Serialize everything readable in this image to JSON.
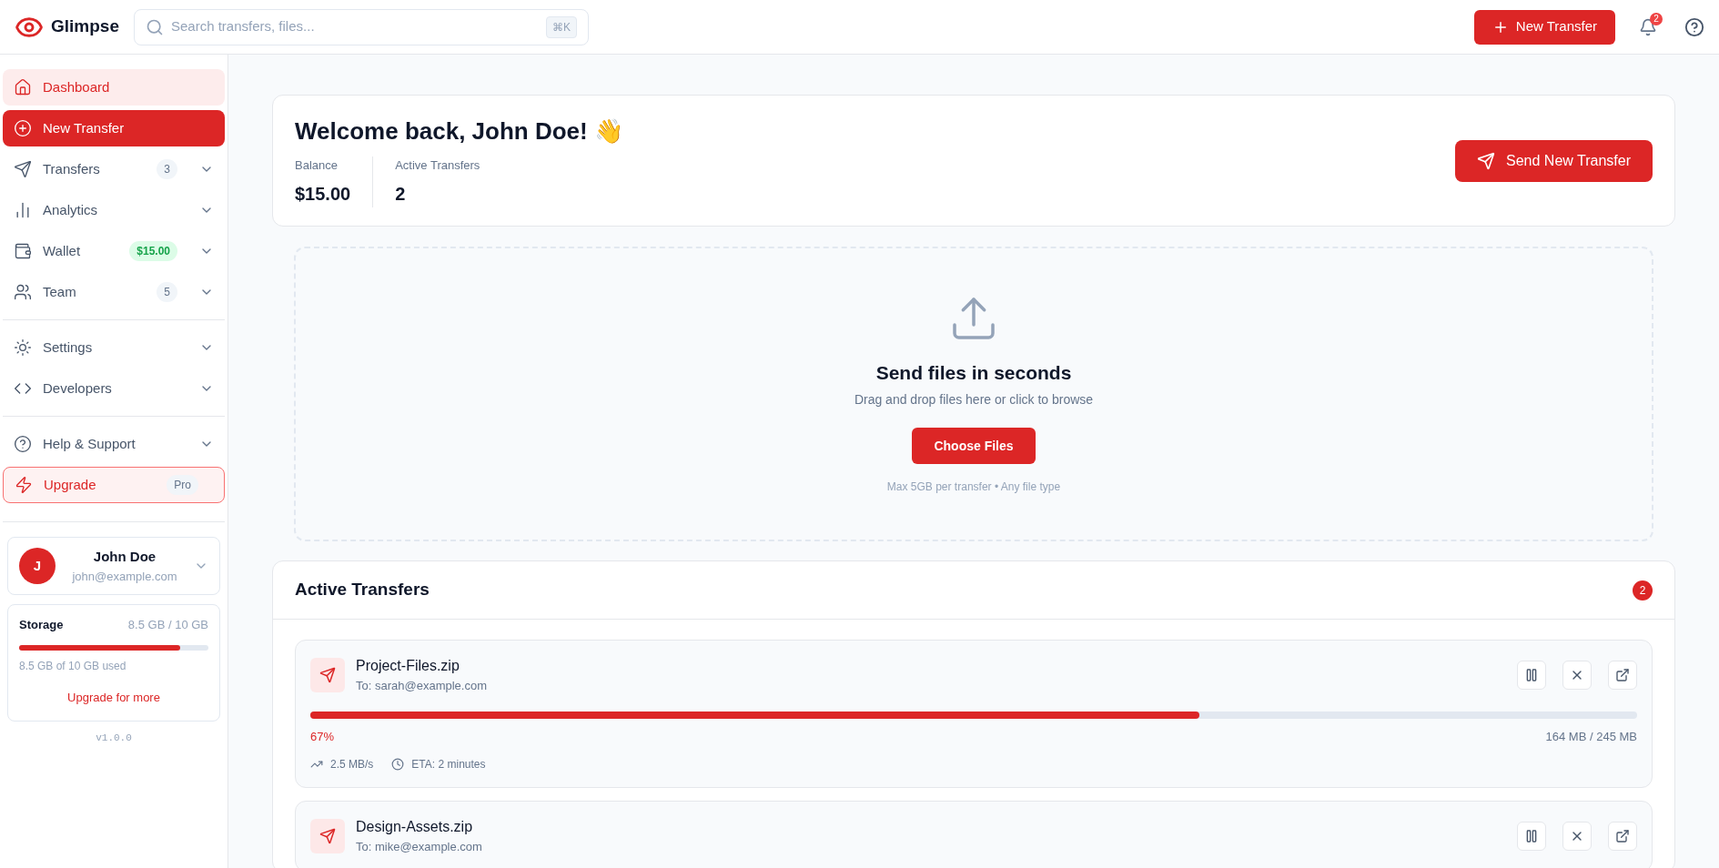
{
  "brand": {
    "name": "Glimpse"
  },
  "search": {
    "placeholder": "Search transfers, files...",
    "shortcut": "⌘K"
  },
  "header": {
    "new_button": "New Transfer",
    "notifications": "2"
  },
  "nav_groups": [
    [
      {
        "label": "Dashboard",
        "kind": "link",
        "selected": true
      },
      {
        "label": "New Transfer",
        "kind": "cta",
        "selected": false
      },
      {
        "label": "Transfers",
        "kind": "link",
        "selected": false,
        "badge": {
          "text": "3",
          "kind": "count"
        },
        "expandable": true
      },
      {
        "label": "Analytics",
        "kind": "link",
        "selected": false,
        "expandable": true
      },
      {
        "label": "Wallet",
        "kind": "link",
        "selected": false,
        "badge": {
          "text": "$15.00",
          "kind": "money"
        },
        "expandable": true
      },
      {
        "label": "Team",
        "kind": "link",
        "selected": false,
        "badge": {
          "text": "5",
          "kind": "count"
        },
        "expandable": true
      }
    ],
    [
      {
        "label": "Settings",
        "kind": "link",
        "selected": false,
        "expandable": true
      },
      {
        "label": "Developers",
        "kind": "link",
        "selected": false,
        "expandable": true
      }
    ],
    [
      {
        "label": "Help & Support",
        "kind": "link",
        "selected": false,
        "expandable": true
      },
      {
        "label": "Upgrade",
        "kind": "upgrade",
        "selected": false,
        "badge": {
          "text": "Pro",
          "kind": "count"
        }
      }
    ]
  ],
  "user": {
    "initial": "J",
    "name": "John Doe",
    "email": "john@example.com"
  },
  "storage": {
    "title": "Storage",
    "reading": "8.5 GB / 10 GB",
    "level": 0.85,
    "note": "8.5 GB of 10 GB used",
    "link": "Upgrade for more"
  },
  "version": "v1.0.0",
  "welcome": {
    "title": "Welcome back, John Doe! 👋",
    "stats": [
      {
        "label": "Balance",
        "value": "$15.00"
      },
      {
        "label": "Active Transfers",
        "value": "2"
      }
    ],
    "button": "Send New Transfer"
  },
  "dropzone": {
    "title": "Send files in seconds",
    "subtitle": "Drag and drop files here or click to browse",
    "button": "Choose Files",
    "note": "Max 5GB per transfer • Any file type"
  },
  "active_transfers": {
    "title": "Active Transfers",
    "count": "2",
    "items": [
      {
        "name": "Project-Files.zip",
        "to": "To: sarah@example.com",
        "level": 0.67,
        "percent": "67%",
        "size": "164 MB / 245 MB",
        "speed": "2.5 MB/s",
        "eta": "ETA: 2 minutes"
      },
      {
        "name": "Design-Assets.zip",
        "to": "To: mike@example.com"
      }
    ]
  }
}
